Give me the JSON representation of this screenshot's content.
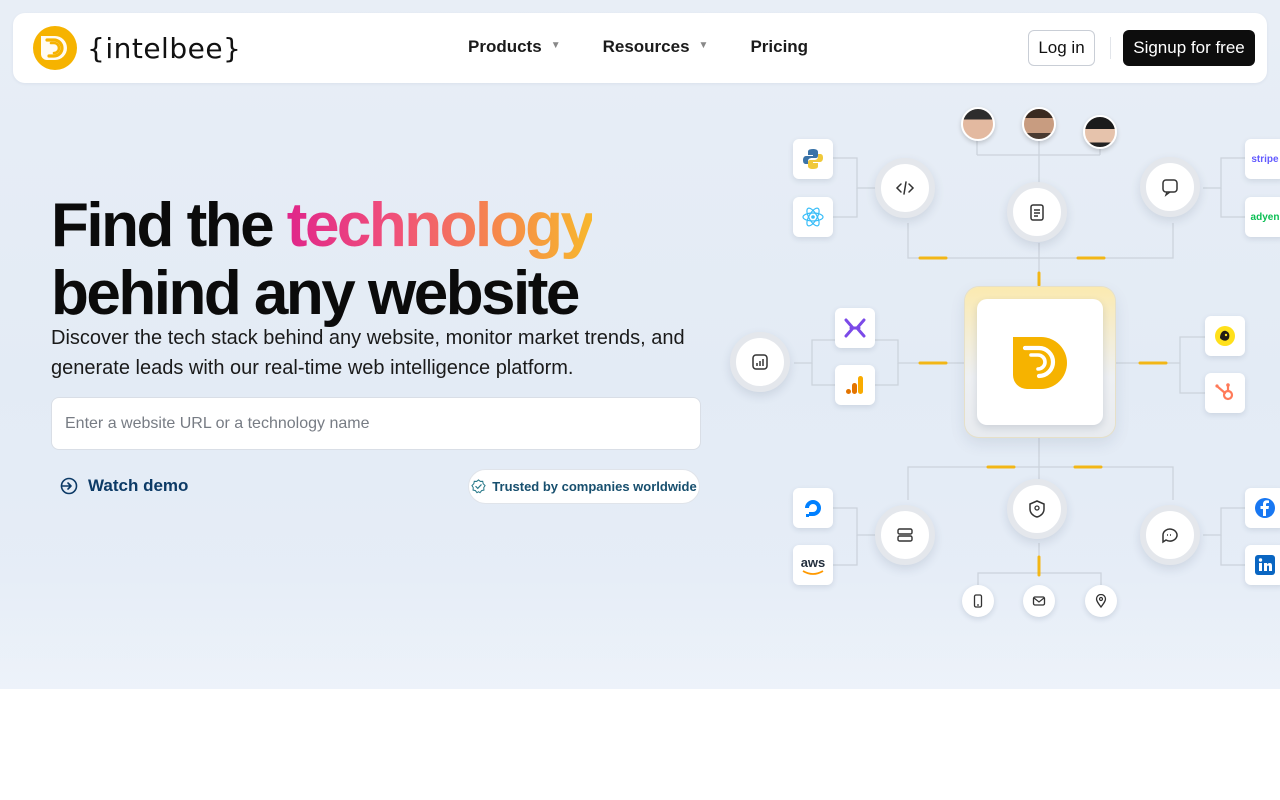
{
  "brand": {
    "name": "{intelbee}",
    "accent": "#f6b300"
  },
  "nav": {
    "products": "Products",
    "resources": "Resources",
    "pricing": "Pricing",
    "login": "Log in",
    "signup": "Signup for free"
  },
  "hero": {
    "headline_part1": "Find the ",
    "headline_accent": "technology",
    "headline_part2": "behind any website",
    "subtext": "Discover the tech stack behind any website, monitor market trends, and generate leads with our real-time web intelligence platform.",
    "search_placeholder": "Enter a website URL or a technology name",
    "watch_demo": "Watch demo",
    "trusted": "Trusted by companies worldwide"
  },
  "diagram": {
    "tiles": {
      "stripe": "stripe",
      "adyen": "adyen",
      "aws": "aws"
    }
  },
  "colors": {
    "headline_gradient": [
      "#e0268a",
      "#f68a4a",
      "#f7b72d"
    ],
    "signup_bg": "#0d0d0d",
    "link_blue": "#0c3a66"
  }
}
